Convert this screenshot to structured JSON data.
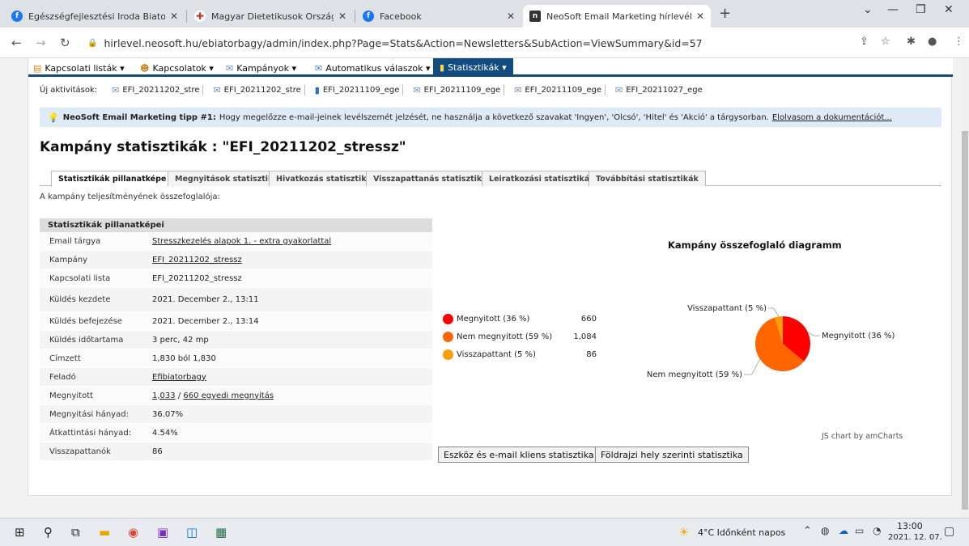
{
  "browser": {
    "tabs": [
      {
        "label": "Egészségfejlesztési Iroda Biatorb",
        "favicon_color": "#1877f2",
        "active": false
      },
      {
        "label": "Magyar Dietetikusok Országos Sz",
        "favicon_color": "#c0392b",
        "active": false
      },
      {
        "label": "Facebook",
        "favicon_color": "#1877f2",
        "active": false
      },
      {
        "label": "NeoSoft Email Marketing hírlevél",
        "favicon_color": "#333333",
        "active": true
      }
    ],
    "url": "hirlevel.neosoft.hu/ebiatorbagy/admin/index.php?Page=Stats&Action=Newsletters&SubAction=ViewSummary&id=57"
  },
  "menu": {
    "items": [
      {
        "label": "Kapcsolati listák",
        "icon": "contacts-icon"
      },
      {
        "label": "Kapcsolatok",
        "icon": "people-icon"
      },
      {
        "label": "Kampányok",
        "icon": "mail-icon"
      },
      {
        "label": "Automatikus válaszok",
        "icon": "autoresponder-icon"
      },
      {
        "label": "Statisztikák",
        "icon": "chart-icon"
      }
    ]
  },
  "activities": {
    "label": "Új aktivitások:",
    "items": [
      {
        "label": "EFI_20211202_stre",
        "icon": "mail-icon"
      },
      {
        "label": "EFI_20211202_stre",
        "icon": "mail-icon"
      },
      {
        "label": "EFI_20211109_ege",
        "icon": "chart-icon"
      },
      {
        "label": "EFI_20211109_ege",
        "icon": "mail-icon"
      },
      {
        "label": "EFI_20211109_ege",
        "icon": "mail-icon"
      },
      {
        "label": "EFI_20211027_ege",
        "icon": "mail-icon"
      }
    ]
  },
  "tip": {
    "title": "NeoSoft Email Marketing tipp #1:",
    "text": "Hogy megelőzze e-mail-jeinek levélszemét jelzését, ne használja a következő szavakat 'Ingyen', 'Olcsó', 'Hitel' és 'Akció' a tárgysorban.",
    "link": "Elolvasom a dokumentációt..."
  },
  "page_title": "Kampány statisztikák : \"EFI_20211202_stressz\"",
  "subtabs": [
    "Statisztikák pillanatképe",
    "Megnyitások statisztikái",
    "Hivatkozás statisztikák",
    "Visszapattanás statisztikák",
    "Leiratkozási statisztikák",
    "Továbbítási statisztikák"
  ],
  "summary_intro": "A kampány teljesítményének összefoglalója:",
  "stats": {
    "header": "Statisztikák pillanatképei",
    "rows": [
      {
        "key": "Email tárgya",
        "value": "Stresszkezelés alapok 1. - extra gyakorlattal",
        "link": true
      },
      {
        "key": "Kampány",
        "value": "EFI_20211202_stressz",
        "link": true
      },
      {
        "key": "Kapcsolati lista",
        "value": "EFI_20211202_stressz",
        "link": false
      },
      {
        "key": "Küldés kezdete",
        "value": "2021. December 2., 13:11",
        "link": false
      },
      {
        "key": "Küldés befejezése",
        "value": "2021. December 2., 13:14",
        "link": false
      },
      {
        "key": "Küldés időtartama",
        "value": "3 perc, 42 mp",
        "link": false
      },
      {
        "key": "Címzett",
        "value": "1,830 ból 1,830",
        "link": false
      },
      {
        "key": "Feladó",
        "value": "Efibiatorbagy",
        "link": true
      },
      {
        "key": "Megnyitott",
        "value_a": "1,033",
        "value_sep": " / ",
        "value_b": "660 egyedi megnyitás",
        "link": true
      },
      {
        "key": "Megnyitási hányad:",
        "value": "36.07%",
        "link": false
      },
      {
        "key": "Átkattintási hányad:",
        "value": "4.54%",
        "link": false
      },
      {
        "key": "Visszapattanók",
        "value": "86",
        "link": false
      }
    ]
  },
  "chart_data": {
    "type": "pie",
    "title": "Kampány összefoglaló diagramm",
    "categories": [
      "Megnyitott (36 %)",
      "Nem megnyitott (59 %)",
      "Visszapattant (5 %)"
    ],
    "values": [
      660,
      1084,
      86
    ],
    "display_values": [
      "660",
      "1,084",
      "86"
    ],
    "colors": [
      "#ff0000",
      "#ff6600",
      "#ff9e01"
    ],
    "credit": "JS chart by amCharts"
  },
  "buttons": {
    "device_stats": "Eszköz és e-mail kliens statisztika",
    "geo_stats": "Földrajzi hely szerinti statisztika"
  },
  "taskbar": {
    "weather": "4°C  Időnként napos",
    "time": "13:00",
    "date": "2021. 12. 07."
  }
}
